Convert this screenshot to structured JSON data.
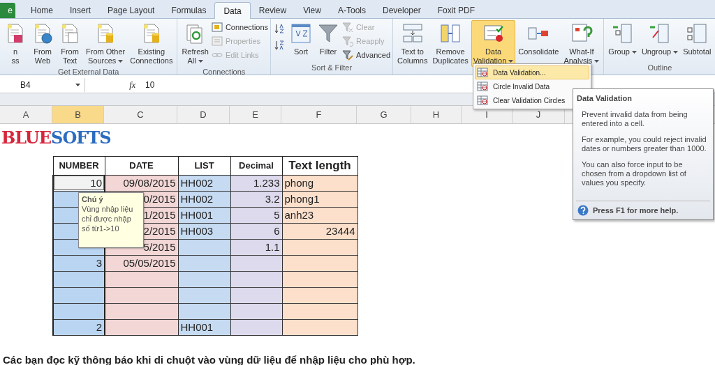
{
  "tabs": [
    {
      "label": "e",
      "kind": "file",
      "selected": false
    },
    {
      "label": "Home",
      "kind": "tab",
      "selected": false
    },
    {
      "label": "Insert",
      "kind": "tab",
      "selected": false
    },
    {
      "label": "Page Layout",
      "kind": "tab",
      "selected": false
    },
    {
      "label": "Formulas",
      "kind": "tab",
      "selected": false
    },
    {
      "label": "Data",
      "kind": "tab",
      "selected": true
    },
    {
      "label": "Review",
      "kind": "tab",
      "selected": false
    },
    {
      "label": "View",
      "kind": "tab",
      "selected": false
    },
    {
      "label": "A-Tools",
      "kind": "tab",
      "selected": false
    },
    {
      "label": "Developer",
      "kind": "tab",
      "selected": false
    },
    {
      "label": "Foxit PDF",
      "kind": "tab",
      "selected": false
    }
  ],
  "ribbon": {
    "groups": [
      {
        "label": "Get External Data",
        "items": [
          {
            "kind": "large",
            "label_lines": [
              "n",
              "ss"
            ],
            "menu": false,
            "pressed": false
          },
          {
            "kind": "large",
            "label_lines": [
              "From",
              "Web"
            ],
            "menu": false,
            "pressed": false
          },
          {
            "kind": "large",
            "label_lines": [
              "From",
              "Text"
            ],
            "menu": false,
            "pressed": false
          },
          {
            "kind": "large",
            "label_lines": [
              "From Other",
              "Sources"
            ],
            "menu": true,
            "pressed": false
          },
          {
            "kind": "large",
            "label_lines": [
              "Existing",
              "Connections"
            ],
            "menu": false,
            "pressed": false
          }
        ]
      },
      {
        "label": "Connections",
        "items": [
          {
            "kind": "large",
            "label_lines": [
              "Refresh",
              "All"
            ],
            "menu": true,
            "pressed": false
          },
          {
            "kind": "small",
            "label": "Connections",
            "disabled": false
          },
          {
            "kind": "small",
            "label": "Properties",
            "disabled": true
          },
          {
            "kind": "small",
            "label": "Edit Links",
            "disabled": true
          }
        ]
      },
      {
        "label": "Sort & Filter",
        "items": [
          {
            "kind": "icon",
            "disabled": false
          },
          {
            "kind": "icon",
            "disabled": false
          },
          {
            "kind": "large",
            "label_lines": [
              "Sort"
            ],
            "menu": false,
            "pressed": false
          },
          {
            "kind": "large",
            "label_lines": [
              "Filter"
            ],
            "menu": false,
            "pressed": false
          },
          {
            "kind": "small",
            "label": "Clear",
            "disabled": true
          },
          {
            "kind": "small",
            "label": "Reapply",
            "disabled": true
          },
          {
            "kind": "small",
            "label": "Advanced",
            "disabled": false
          }
        ]
      },
      {
        "items": [
          {
            "kind": "large",
            "label_lines": [
              "Text to",
              "Columns"
            ],
            "menu": false,
            "pressed": false
          },
          {
            "kind": "large",
            "label_lines": [
              "Remove",
              "Duplicates"
            ],
            "menu": false,
            "pressed": false
          },
          {
            "kind": "large",
            "label_lines": [
              "Data",
              "Validation"
            ],
            "menu": true,
            "pressed": true
          },
          {
            "kind": "large",
            "label_lines": [
              "Consolidate"
            ],
            "menu": false,
            "pressed": false
          },
          {
            "kind": "large",
            "label_lines": [
              "What-If",
              "Analysis"
            ],
            "menu": true,
            "pressed": false
          }
        ]
      },
      {
        "label": "Outline",
        "items": [
          {
            "kind": "large",
            "label_lines": [
              "Group"
            ],
            "menu": true,
            "pressed": false
          },
          {
            "kind": "large",
            "label_lines": [
              "Ungroup"
            ],
            "menu": true,
            "pressed": false
          },
          {
            "kind": "large",
            "label_lines": [
              "Subtotal"
            ],
            "menu": false,
            "pressed": false
          }
        ]
      }
    ]
  },
  "dropdown_menu": {
    "items": [
      {
        "label": "Data Validation...",
        "selected": true
      },
      {
        "label": "Circle Invalid Data",
        "selected": false
      },
      {
        "label": "Clear Validation Circles",
        "selected": false
      }
    ]
  },
  "formula_bar": {
    "name_box": "B4",
    "function_label": "fx",
    "value": "10"
  },
  "column_headers": [
    {
      "label": "A",
      "selected": false
    },
    {
      "label": "B",
      "selected": true
    },
    {
      "label": "C",
      "selected": false
    },
    {
      "label": "D",
      "selected": false
    },
    {
      "label": "E",
      "selected": false
    },
    {
      "label": "F",
      "selected": false
    },
    {
      "label": "G",
      "selected": false
    },
    {
      "label": "H",
      "selected": false
    },
    {
      "label": "I",
      "selected": false
    },
    {
      "label": "J",
      "selected": false
    }
  ],
  "logo": {
    "part_1": "BLUE",
    "part_2": "SOFTS"
  },
  "table": {
    "columns": [
      {
        "label": "NUMBER",
        "color": "#bad5f2"
      },
      {
        "label": "DATE",
        "color": "#f2d7d6"
      },
      {
        "label": "LIST",
        "color": "#c6dbf2"
      },
      {
        "label": "Decimal",
        "color": "#dedaed"
      },
      {
        "label": "Text length",
        "color": "#fce0cc"
      }
    ],
    "rows": [
      {
        "number": "10",
        "date": "09/08/2015",
        "list": "HH002",
        "decimal": "1.233",
        "text_length": "phong",
        "text_is_number": false,
        "selected": true
      },
      {
        "date": "0/2015",
        "list": "HH002",
        "decimal": "3.2",
        "text_length": "phong1",
        "text_is_number": false,
        "selected": false
      },
      {
        "date": "1/2015",
        "list": "HH001",
        "decimal": "5",
        "text_length": "anh23",
        "text_is_number": false,
        "selected": false
      },
      {
        "date": "2/2015",
        "list": "HH003",
        "decimal": "6",
        "text_length": "23444",
        "text_is_number": true,
        "selected": false
      },
      {
        "date": "5/2015",
        "decimal": "1.1",
        "selected": false
      },
      {
        "number": "3",
        "date": "05/05/2015",
        "selected": false
      },
      {
        "selected": false
      },
      {
        "selected": false
      },
      {
        "selected": false
      },
      {
        "number": "2",
        "list": "HH001",
        "selected": false
      }
    ]
  },
  "comment": {
    "title": "Chú ý",
    "text": "Vùng nhập liệu chỉ được nhập số từ1->10"
  },
  "tooltip": {
    "title": "Data Validation",
    "paragraphs": [
      "Prevent invalid data from being entered into a cell.",
      "For example, you could reject invalid dates or numbers greater than 1000.",
      "You can also force input to be chosen from a dropdown list of values you specify."
    ],
    "help": "Press F1 for more help."
  },
  "note": "Các bạn đọc kỹ thông báo khi di chuột vào vùng dữ liệu để nhập liệu cho phù hợp."
}
